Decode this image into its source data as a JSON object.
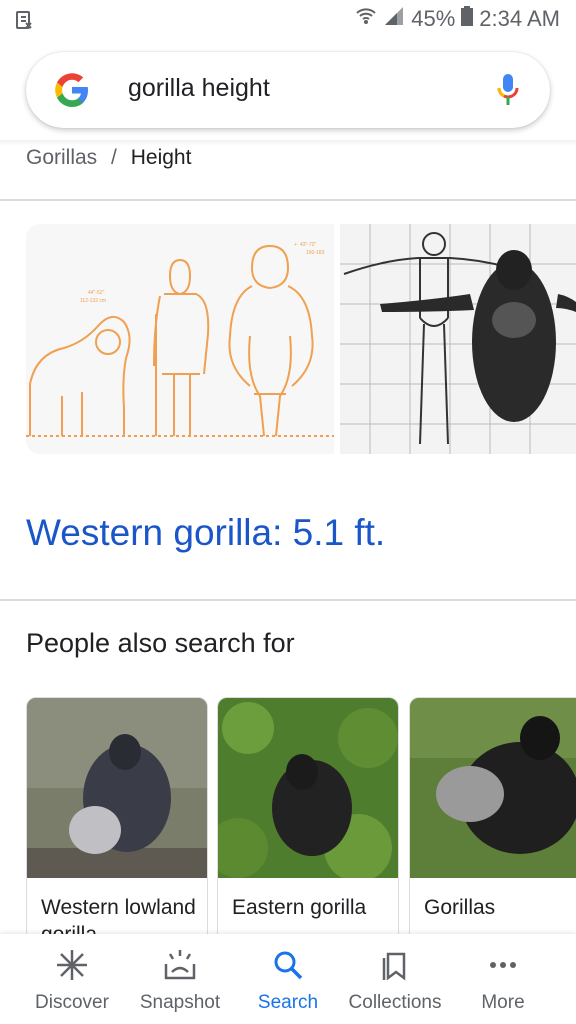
{
  "status_bar": {
    "battery": "45%",
    "time": "2:34 AM"
  },
  "search": {
    "query": "gorilla height"
  },
  "breadcrumb": {
    "parent": "Gorillas",
    "separator": "/",
    "current": "Height"
  },
  "answer": {
    "text": "Western gorilla: 5.1 ft."
  },
  "people_also_search": {
    "title": "People also search for",
    "items": [
      {
        "label": "Western lowland gorilla"
      },
      {
        "label": "Eastern gorilla"
      },
      {
        "label": "Gorillas"
      }
    ]
  },
  "bottom_nav": {
    "items": [
      {
        "label": "Discover",
        "icon": "asterisk-icon"
      },
      {
        "label": "Snapshot",
        "icon": "snapshot-icon"
      },
      {
        "label": "Search",
        "icon": "search-icon",
        "active": true
      },
      {
        "label": "Collections",
        "icon": "bookmarks-icon"
      },
      {
        "label": "More",
        "icon": "more-dots-icon"
      }
    ]
  },
  "colors": {
    "accent": "#1a73e8",
    "answer_blue": "#1a56c8"
  }
}
